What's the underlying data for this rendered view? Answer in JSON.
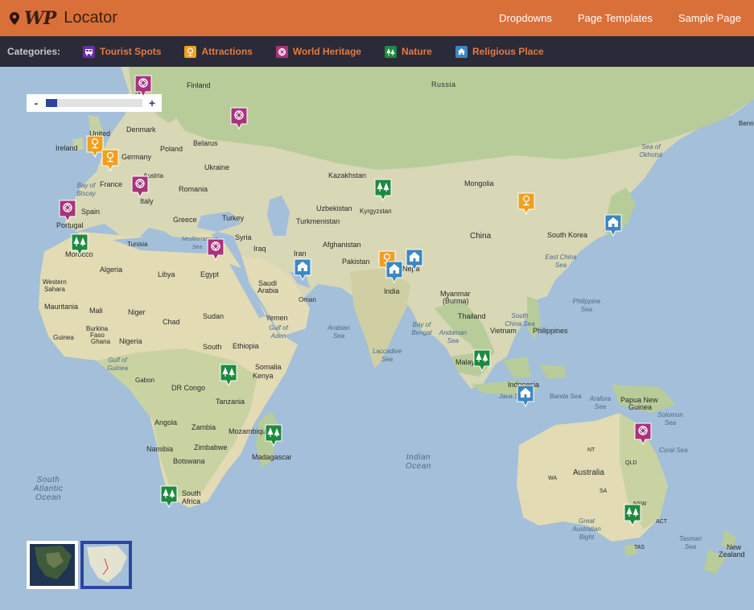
{
  "header": {
    "brand_wp": "WP",
    "brand_rest": "Locator",
    "nav": [
      "Dropdowns",
      "Page Templates",
      "Sample Page"
    ],
    "bg_color": "#d9703a"
  },
  "categories": {
    "label": "Categories:",
    "items": [
      {
        "name": "Tourist Spots",
        "color": "#6b2fa0",
        "icon": "tourist-spots-icon"
      },
      {
        "name": "Attractions",
        "color": "#f0a020",
        "icon": "attractions-icon"
      },
      {
        "name": "World Heritage",
        "color": "#a8347c",
        "icon": "world-heritage-icon"
      },
      {
        "name": "Nature",
        "color": "#1e8a3e",
        "icon": "nature-icon"
      },
      {
        "name": "Religious Place",
        "color": "#3d87c2",
        "icon": "religious-place-icon"
      }
    ]
  },
  "map": {
    "zoom_minus": "-",
    "zoom_plus": "+",
    "zoom_level": 0.12,
    "places": [
      {
        "label": "Russia",
        "kind": "big"
      },
      {
        "label": "Finland",
        "kind": "big"
      },
      {
        "label": "Nor",
        "kind": "big"
      },
      {
        "label": "Denmark",
        "kind": "big"
      },
      {
        "label": "United",
        "kind": "big"
      },
      {
        "label": "Ireland",
        "kind": "big"
      },
      {
        "label": "Germany",
        "kind": "big"
      },
      {
        "label": "Poland",
        "kind": "big"
      },
      {
        "label": "Belarus",
        "kind": "big"
      },
      {
        "label": "Ukraine",
        "kind": "big"
      },
      {
        "label": "Austria",
        "kind": "big"
      },
      {
        "label": "France",
        "kind": "big"
      },
      {
        "label": "Romania",
        "kind": "big"
      },
      {
        "label": "Italy",
        "kind": "big"
      },
      {
        "label": "Spain",
        "kind": "big"
      },
      {
        "label": "Portugal",
        "kind": "big"
      },
      {
        "label": "Greece",
        "kind": "big"
      },
      {
        "label": "Turkey",
        "kind": "big"
      },
      {
        "label": "Kazakhstan",
        "kind": "big"
      },
      {
        "label": "Uzbekistan",
        "kind": "big"
      },
      {
        "label": "Kyrgyzstan",
        "kind": "big"
      },
      {
        "label": "Turkmenistan",
        "kind": "big"
      },
      {
        "label": "Mongolia",
        "kind": "big"
      },
      {
        "label": "China",
        "kind": "big"
      },
      {
        "label": "South Korea",
        "kind": "big"
      },
      {
        "label": "Afghanistan",
        "kind": "big"
      },
      {
        "label": "Iran",
        "kind": "big"
      },
      {
        "label": "Iraq",
        "kind": "big"
      },
      {
        "label": "Syria",
        "kind": "big"
      },
      {
        "label": "Pakistan",
        "kind": "big"
      },
      {
        "label": "Nepa",
        "kind": "big"
      },
      {
        "label": "India",
        "kind": "big"
      },
      {
        "label": "Tunisia",
        "kind": "big"
      },
      {
        "label": "Morocco",
        "kind": "big"
      },
      {
        "label": "Algeria",
        "kind": "big"
      },
      {
        "label": "Libya",
        "kind": "big"
      },
      {
        "label": "Egypt",
        "kind": "big"
      },
      {
        "label": "Saudi",
        "kind": "big"
      },
      {
        "label": "Arabia",
        "kind": "big"
      },
      {
        "label": "Oman",
        "kind": "big"
      },
      {
        "label": "Yemen",
        "kind": "big"
      },
      {
        "label": "Western",
        "kind": "big"
      },
      {
        "label": "Sahara",
        "kind": "big"
      },
      {
        "label": "Mauritania",
        "kind": "big"
      },
      {
        "label": "Mali",
        "kind": "big"
      },
      {
        "label": "Niger",
        "kind": "big"
      },
      {
        "label": "Chad",
        "kind": "big"
      },
      {
        "label": "Sudan",
        "kind": "big"
      },
      {
        "label": "Burkina",
        "kind": "big"
      },
      {
        "label": "Faso",
        "kind": "big"
      },
      {
        "label": "Guinea",
        "kind": "big"
      },
      {
        "label": "Ghana",
        "kind": "big"
      },
      {
        "label": "Nigeria",
        "kind": "big"
      },
      {
        "label": "South",
        "kind": "big"
      },
      {
        "label": "Ethiopia",
        "kind": "big"
      },
      {
        "label": "Somalia",
        "kind": "big"
      },
      {
        "label": "Gabon",
        "kind": "big"
      },
      {
        "label": "DR Congo",
        "kind": "big"
      },
      {
        "label": "Kenya",
        "kind": "big"
      },
      {
        "label": "Tanzania",
        "kind": "big"
      },
      {
        "label": "Angola",
        "kind": "big"
      },
      {
        "label": "Zambia",
        "kind": "big"
      },
      {
        "label": "Namibia",
        "kind": "big"
      },
      {
        "label": "Zimbabwe",
        "kind": "big"
      },
      {
        "label": "Botswana",
        "kind": "big"
      },
      {
        "label": "Mozambique",
        "kind": "big"
      },
      {
        "label": "Madagascar",
        "kind": "big"
      },
      {
        "label": "South Africa",
        "kind": "big"
      },
      {
        "label": "Myanmar",
        "kind": "big"
      },
      {
        "label": "(Burma)",
        "kind": "big"
      },
      {
        "label": "Thailand",
        "kind": "big"
      },
      {
        "label": "Vietnam",
        "kind": "big"
      },
      {
        "label": "Philippines",
        "kind": "big"
      },
      {
        "label": "Malaysia",
        "kind": "big"
      },
      {
        "label": "Indonesia",
        "kind": "big"
      },
      {
        "label": "Papua New",
        "kind": "big"
      },
      {
        "label": "Guinea",
        "kind": "big"
      },
      {
        "label": "Australia",
        "kind": "big"
      },
      {
        "label": "NT",
        "kind": "big"
      },
      {
        "label": "QLD",
        "kind": "big"
      },
      {
        "label": "WA",
        "kind": "big"
      },
      {
        "label": "SA",
        "kind": "big"
      },
      {
        "label": "NSW",
        "kind": "big"
      },
      {
        "label": "ACT",
        "kind": "big"
      },
      {
        "label": "TAS",
        "kind": "big"
      },
      {
        "label": "New",
        "kind": "big"
      },
      {
        "label": "Zealand",
        "kind": "big"
      },
      {
        "label": "Benn",
        "kind": "big"
      }
    ],
    "waters": [
      "Sea of Okhotsk",
      "Bay of Biscay",
      "Mediterranean Sea",
      "Arabian Sea",
      "Gulf of Aden",
      "Laccadive Sea",
      "Bay of Bengal",
      "Andaman Sea",
      "South China Sea",
      "East China Sea",
      "Philippine Sea",
      "Gulf of Guinea",
      "Java Sea",
      "Banda Sea",
      "Arafura Sea",
      "Solomon Sea",
      "Coral Sea",
      "Great Australian Bight",
      "Tasman Sea"
    ],
    "oceans": [
      "South Atlantic Ocean",
      "Indian Ocean"
    ],
    "markers": [
      {
        "category": "World Heritage",
        "name": "marker-world-heritage-norway"
      },
      {
        "category": "World Heritage",
        "name": "marker-world-heritage-moscow"
      },
      {
        "category": "Attractions",
        "name": "marker-attractions-uk"
      },
      {
        "category": "Attractions",
        "name": "marker-attractions-belgium"
      },
      {
        "category": "World Heritage",
        "name": "marker-world-heritage-switzerland"
      },
      {
        "category": "World Heritage",
        "name": "marker-world-heritage-spain"
      },
      {
        "category": "Nature",
        "name": "marker-nature-morocco"
      },
      {
        "category": "World Heritage",
        "name": "marker-world-heritage-israel"
      },
      {
        "category": "Nature",
        "name": "marker-nature-kazakhstan"
      },
      {
        "category": "Religious Place",
        "name": "marker-religious-place-iran"
      },
      {
        "category": "Attractions",
        "name": "marker-attractions-india-north"
      },
      {
        "category": "Religious Place",
        "name": "marker-religious-place-nepal"
      },
      {
        "category": "Religious Place",
        "name": "marker-religious-place-india"
      },
      {
        "category": "Attractions",
        "name": "marker-attractions-china"
      },
      {
        "category": "Religious Place",
        "name": "marker-religious-place-japan"
      },
      {
        "category": "Nature",
        "name": "marker-nature-kenya"
      },
      {
        "category": "Nature",
        "name": "marker-nature-madagascar"
      },
      {
        "category": "Nature",
        "name": "marker-nature-south-africa"
      },
      {
        "category": "Nature",
        "name": "marker-nature-malaysia"
      },
      {
        "category": "Religious Place",
        "name": "marker-religious-place-java"
      },
      {
        "category": "World Heritage",
        "name": "marker-world-heritage-australia"
      },
      {
        "category": "Nature",
        "name": "marker-nature-australia"
      }
    ],
    "map_type_thumbs": [
      "satellite-view-thumb",
      "map-view-thumb"
    ]
  }
}
